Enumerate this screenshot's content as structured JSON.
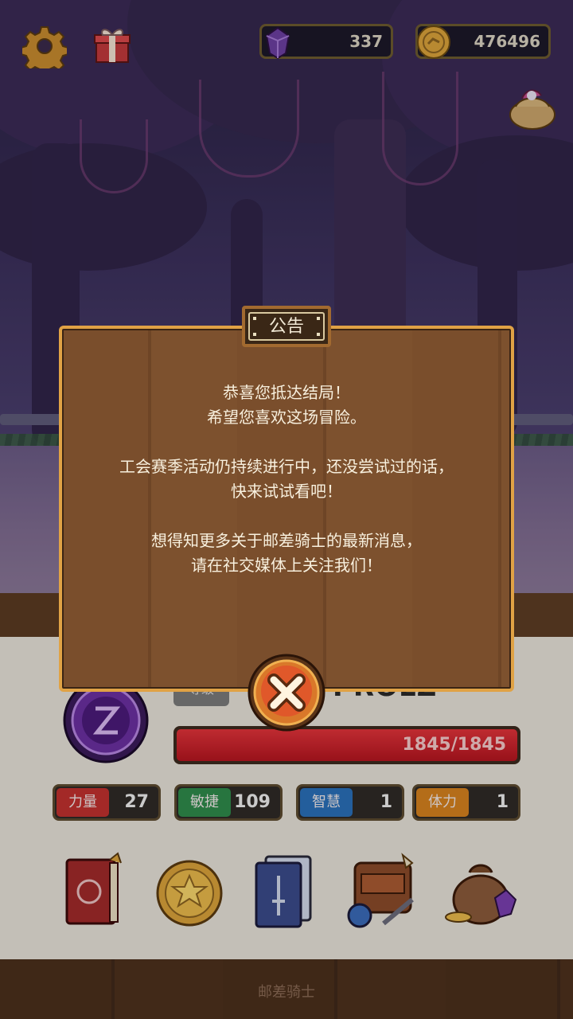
{
  "topbar": {
    "gems": "337",
    "coins": "476496",
    "icons": [
      "gear-icon",
      "gift-icon",
      "gem-icon",
      "coin-icon",
      "loot-bag-icon"
    ]
  },
  "dialog": {
    "title": "公告",
    "paragraphs": [
      [
        "恭喜您抵达结局！",
        "希望您喜欢这场冒险。"
      ],
      [
        "工会赛季活动仍持续进行中，还没尝试过的话，",
        "快来试试看吧！"
      ],
      [
        "想得知更多关于邮差骑士的最新消息，",
        "请在社交媒体上关注我们！"
      ]
    ],
    "close_icon": "close-x-icon"
  },
  "player": {
    "level_label": "等级",
    "name": "PROLZ",
    "hp": "1845/1845",
    "hp_ratio": 1.0,
    "stats": [
      {
        "label": "力量",
        "value": "27",
        "color": "#c0312e"
      },
      {
        "label": "敏捷",
        "value": "109",
        "color": "#2e8a4a"
      },
      {
        "label": "智慧",
        "value": "1",
        "color": "#2a6fb8"
      },
      {
        "label": "体力",
        "value": "1",
        "color": "#d4801e"
      }
    ]
  },
  "menu": [
    "spellbook-icon",
    "star-coin-icon",
    "card-deck-icon",
    "backpack-potion-icon",
    "treasure-bag-icon"
  ],
  "footer": {
    "title": "邮差骑士"
  },
  "colors": {
    "dialog_border": "#e0a245",
    "hp_red": "#d02430",
    "wood": "#7a4e2c"
  }
}
